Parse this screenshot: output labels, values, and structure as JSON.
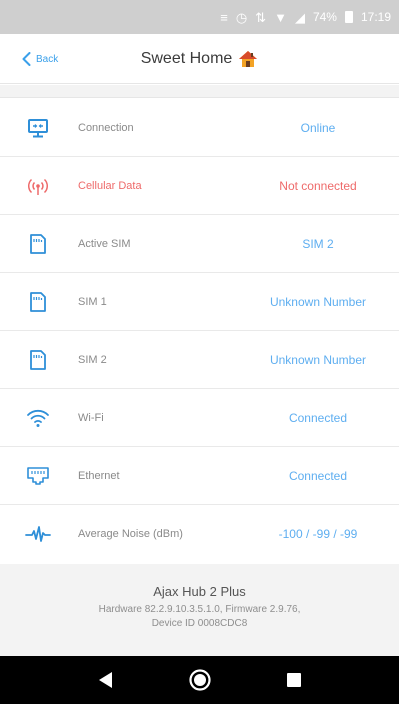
{
  "status_bar": {
    "battery_percent": "74%",
    "time": "17:19"
  },
  "header": {
    "back_label": "Back",
    "title": "Sweet Home"
  },
  "rows": [
    {
      "name": "connection",
      "label": "Connection",
      "value": "Online",
      "icon": "monitor-icon"
    },
    {
      "name": "cellular-data",
      "label": "Cellular Data",
      "value": "Not connected",
      "icon": "antenna-signal-icon"
    },
    {
      "name": "active-sim",
      "label": "Active SIM",
      "value": "SIM 2",
      "icon": "sim-card-icon"
    },
    {
      "name": "sim-1",
      "label": "SIM 1",
      "value": "Unknown Number",
      "icon": "sim-card-icon"
    },
    {
      "name": "sim-2",
      "label": "SIM 2",
      "value": "Unknown Number",
      "icon": "sim-card-icon"
    },
    {
      "name": "wifi",
      "label": "Wi-Fi",
      "value": "Connected",
      "icon": "wifi-icon"
    },
    {
      "name": "ethernet",
      "label": "Ethernet",
      "value": "Connected",
      "icon": "ethernet-port-icon"
    },
    {
      "name": "average-noise",
      "label": "Average Noise (dBm)",
      "value": "-100 / -99 / -99",
      "icon": "pulse-icon"
    }
  ],
  "footer": {
    "device_name": "Ajax Hub 2 Plus",
    "hardware_line": "Hardware 82.2.9.10.3.5.1.0, Firmware 2.9.76,",
    "device_id_line": "Device ID 0008CDC8"
  },
  "colors": {
    "accent": "#3aa0ea",
    "value_blue": "#5eaef0",
    "alert_red": "#ee6a6a"
  }
}
